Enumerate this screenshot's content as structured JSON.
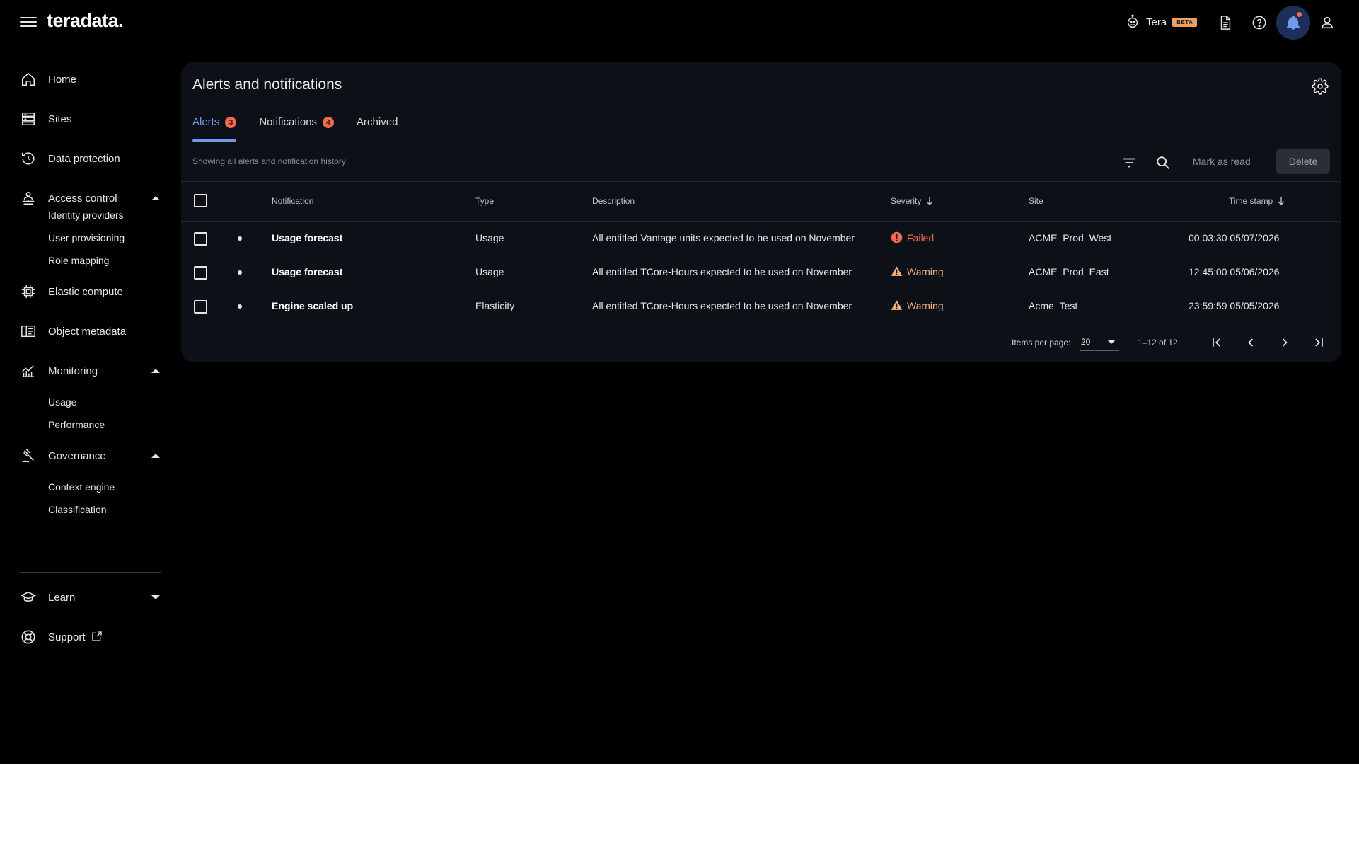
{
  "app": {
    "logo": "teradata."
  },
  "header": {
    "tera_label": "Tera",
    "beta_label": "BETA",
    "icons": [
      "tera-bot-icon",
      "document-icon",
      "help-icon",
      "bell-icon",
      "user-icon"
    ]
  },
  "sidebar": {
    "items": [
      {
        "label": "Home",
        "icon": "home-icon"
      },
      {
        "label": "Sites",
        "icon": "server-icon"
      },
      {
        "label": "Data protection",
        "icon": "history-icon"
      },
      {
        "label": "Access control",
        "icon": "access-control-icon",
        "expanded": true,
        "children": [
          "Identity providers",
          "User provisioning",
          "Role mapping"
        ]
      },
      {
        "label": "Elastic compute",
        "icon": "chip-icon"
      },
      {
        "label": "Object metadata",
        "icon": "book-icon"
      },
      {
        "label": "Monitoring",
        "icon": "chart-icon",
        "expanded": true,
        "children": [
          "Usage",
          "Performance"
        ]
      },
      {
        "label": "Governance",
        "icon": "gavel-icon",
        "expanded": true,
        "children": [
          "Context engine",
          "Classification"
        ]
      },
      {
        "label": "Learn",
        "icon": "graduation-cap-icon",
        "expanded": false
      },
      {
        "label": "Support",
        "icon": "lifebuoy-icon"
      }
    ]
  },
  "main": {
    "title": "Alerts and notifications",
    "tabs": [
      {
        "label": "Alerts",
        "badge": "3",
        "active": true
      },
      {
        "label": "Notifications",
        "badge": "4",
        "active": false
      },
      {
        "label": "Archived",
        "badge": "",
        "active": false
      }
    ],
    "toolbar": {
      "summary": "Showing all alerts and notification history",
      "mark_read_label": "Mark as read",
      "delete_label": "Delete"
    },
    "table": {
      "columns": [
        "Notification",
        "Type",
        "Description",
        "Severity",
        "Site",
        "Time stamp"
      ],
      "rows": [
        {
          "notification": "Usage forecast",
          "type": "Usage",
          "description": "All entitled Vantage units expected to be used on November",
          "severity": "Failed",
          "site": "ACME_Prod_West",
          "timestamp": "00:03:30 05/07/2026"
        },
        {
          "notification": "Usage forecast",
          "type": "Usage",
          "description": "All entitled TCore-Hours expected to be used on November",
          "severity": "Warning",
          "site": "ACME_Prod_East",
          "timestamp": "12:45:00 05/06/2026"
        },
        {
          "notification": "Engine scaled up",
          "type": "Elasticity",
          "description": "All entitled TCore-Hours expected to be used on November",
          "severity": "Warning",
          "site": "Acme_Test",
          "timestamp": "23:59:59 05/05/2026"
        }
      ]
    },
    "pagination": {
      "items_per_page_label": "Items per page:",
      "items_per_page": "20",
      "range": "1–12 of 12"
    }
  },
  "colors": {
    "accent": "#6f9be8",
    "failed": "#f26a4f",
    "warning": "#f3b07a",
    "badge": "#f26a4f",
    "card_bg": "#0d1117"
  }
}
